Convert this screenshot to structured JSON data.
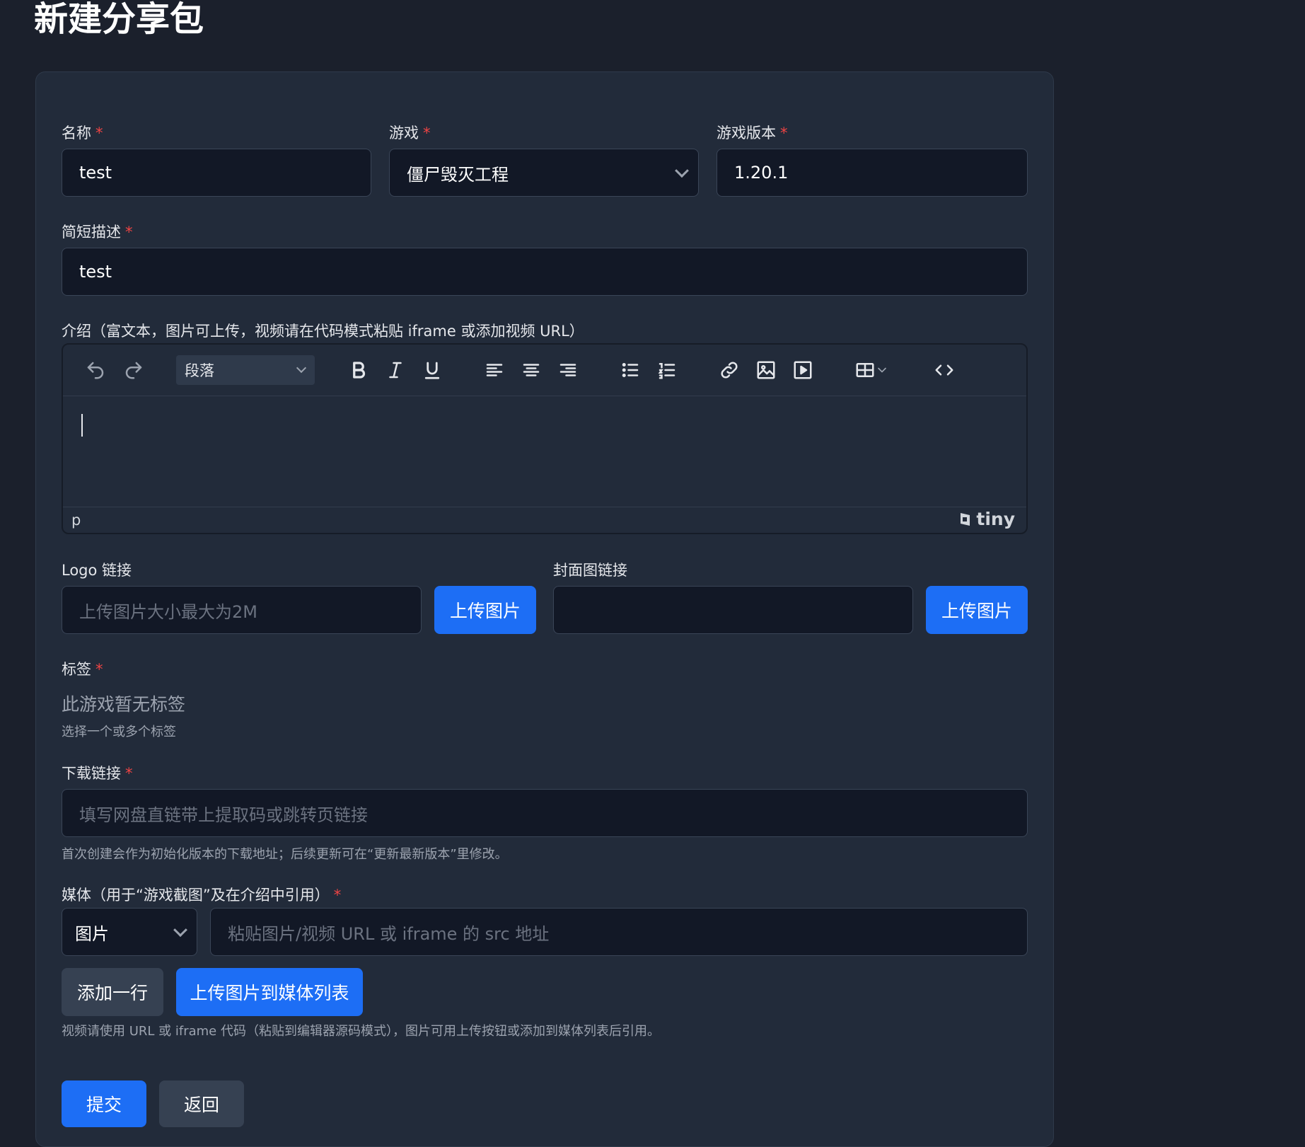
{
  "page": {
    "title": "新建分享包"
  },
  "form": {
    "required_mark": "*",
    "name": {
      "label": "名称",
      "value": "test"
    },
    "game": {
      "label": "游戏",
      "value": "僵尸毁灭工程"
    },
    "game_version": {
      "label": "游戏版本",
      "value": "1.20.1"
    },
    "short_desc": {
      "label": "简短描述",
      "value": "test"
    },
    "intro": {
      "label": "介绍（富文本，图片可上传，视频请在代码模式粘贴 iframe 或添加视频 URL）",
      "format_value": "段落",
      "status_path": "p",
      "brand": "tiny"
    },
    "logo": {
      "label": "Logo 链接",
      "placeholder": "上传图片大小最大为2M",
      "upload_label": "上传图片"
    },
    "cover": {
      "label": "封面图链接",
      "value": "",
      "upload_label": "上传图片"
    },
    "tags": {
      "label": "标签",
      "empty_text": "此游戏暂无标签",
      "hint": "选择一个或多个标签"
    },
    "download": {
      "label": "下载链接",
      "placeholder": "填写网盘直链带上提取码或跳转页链接",
      "hint": "首次创建会作为初始化版本的下载地址；后续更新可在“更新最新版本”里修改。"
    },
    "media": {
      "label": "媒体（用于“游戏截图”及在介绍中引用）",
      "type_value": "图片",
      "url_placeholder": "粘贴图片/视频 URL 或 iframe 的 src 地址",
      "add_row_label": "添加一行",
      "upload_label": "上传图片到媒体列表",
      "hint": "视频请使用 URL 或 iframe 代码（粘贴到编辑器源码模式），图片可用上传按钮或添加到媒体列表后引用。"
    },
    "submit_label": "提交",
    "back_label": "返回"
  },
  "icons": {
    "undo": "undo-icon",
    "redo": "redo-icon",
    "bold": "bold-icon",
    "italic": "italic-icon",
    "underline": "underline-icon",
    "align_left": "align-left-icon",
    "align_center": "align-center-icon",
    "align_right": "align-right-icon",
    "bullet_list": "bullet-list-icon",
    "numbered_list": "numbered-list-icon",
    "link": "link-icon",
    "image": "image-icon",
    "media": "media-icon",
    "table": "table-icon",
    "code": "code-icon"
  },
  "colors": {
    "accent": "#1d6ef5",
    "required": "#ef4444",
    "card_bg": "#222b3a",
    "input_bg": "#121826"
  }
}
